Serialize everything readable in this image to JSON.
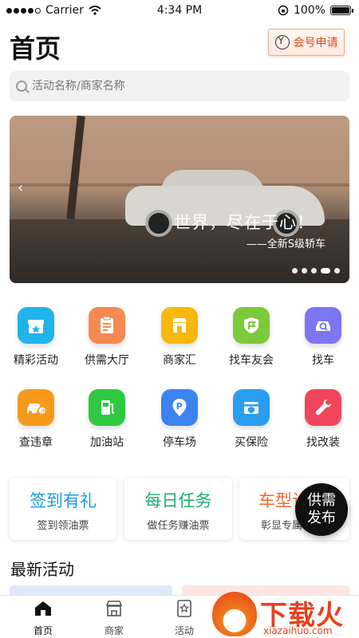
{
  "status_bar": {
    "carrier": "Carrier",
    "time": "4:34 PM",
    "battery": "100%"
  },
  "header": {
    "title": "首页",
    "apply_button": "会号申请"
  },
  "search": {
    "placeholder": "活动名称/商家名称"
  },
  "banner": {
    "headline": "世界，尽在于心！",
    "subline": "——全新S级轿车",
    "page_count": 5,
    "active_page": 4
  },
  "grid": [
    {
      "label": "精彩活动",
      "icon": "gift-box-icon",
      "color": "#1fb4ea"
    },
    {
      "label": "供需大厅",
      "icon": "clipboard-icon",
      "color": "#f48a52"
    },
    {
      "label": "商家汇",
      "icon": "shop-icon",
      "color": "#f8b80c"
    },
    {
      "label": "找车友会",
      "icon": "flag-shield-icon",
      "color": "#7cc93a"
    },
    {
      "label": "找车",
      "icon": "car-search-icon",
      "color": "#7d76f1"
    },
    {
      "label": "查违章",
      "icon": "car-violation-icon",
      "color": "#f59a1b"
    },
    {
      "label": "加油站",
      "icon": "fuel-pump-icon",
      "color": "#2ec940"
    },
    {
      "label": "停车场",
      "icon": "parking-pin-icon",
      "color": "#3d82f1"
    },
    {
      "label": "买保险",
      "icon": "insurance-icon",
      "color": "#2a9df0"
    },
    {
      "label": "找改装",
      "icon": "wrench-icon",
      "color": "#f0455a"
    }
  ],
  "tasks": [
    {
      "title": "签到有礼",
      "subtitle": "签到领油票",
      "color": "#1a9be6"
    },
    {
      "title": "每日任务",
      "subtitle": "做任务赚油票",
      "color": "#1fae6b"
    },
    {
      "title": "车型认",
      "subtitle": "彰显专属",
      "color": "#ee6a2a"
    }
  ],
  "fab": {
    "label": "供需发布"
  },
  "section": {
    "title": "最新活动"
  },
  "tabbar": [
    {
      "label": "首页",
      "icon": "home-icon",
      "active": true
    },
    {
      "label": "商家",
      "icon": "store-icon",
      "active": false
    },
    {
      "label": "活动",
      "icon": "star-ticket-icon",
      "active": false
    }
  ],
  "watermark": {
    "brand": "下载火",
    "url": "xiazaihuo.com"
  }
}
